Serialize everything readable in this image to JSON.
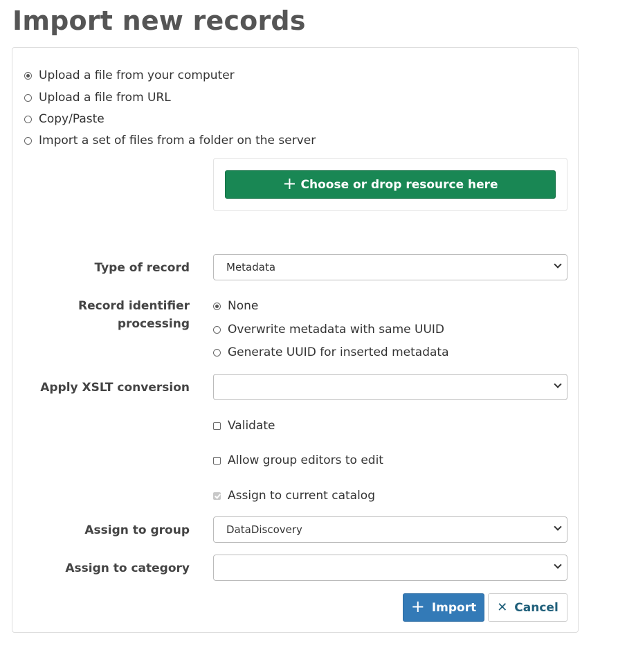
{
  "page": {
    "title": "Import new records"
  },
  "source_options": [
    {
      "label": "Upload a file from your computer",
      "checked": true
    },
    {
      "label": "Upload a file from URL",
      "checked": false
    },
    {
      "label": "Copy/Paste",
      "checked": false
    },
    {
      "label": "Import a set of files from a folder on the server",
      "checked": false
    }
  ],
  "upload": {
    "choose_label": "Choose or drop resource here"
  },
  "type_of_record": {
    "label": "Type of record",
    "selected": "Metadata"
  },
  "identifier_processing": {
    "label_line1": "Record identifier",
    "label_line2": "processing",
    "options": [
      {
        "label": "None",
        "checked": true
      },
      {
        "label": "Overwrite metadata with same UUID",
        "checked": false
      },
      {
        "label": "Generate UUID for inserted metadata",
        "checked": false
      }
    ]
  },
  "xslt": {
    "label": "Apply XSLT conversion",
    "selected": ""
  },
  "checkboxes": {
    "validate": {
      "label": "Validate",
      "checked": false
    },
    "group_editors": {
      "label": "Allow group editors to edit",
      "checked": false
    },
    "current_catalog": {
      "label": "Assign to current catalog",
      "checked": true,
      "disabled": true
    }
  },
  "group": {
    "label": "Assign to group",
    "selected": "DataDiscovery"
  },
  "category": {
    "label": "Assign to category",
    "selected": ""
  },
  "actions": {
    "import_label": "Import",
    "cancel_label": "Cancel"
  },
  "colors": {
    "choose_button": "#198754",
    "import_button": "#337ab7",
    "cancel_text": "#1f5f7a"
  }
}
